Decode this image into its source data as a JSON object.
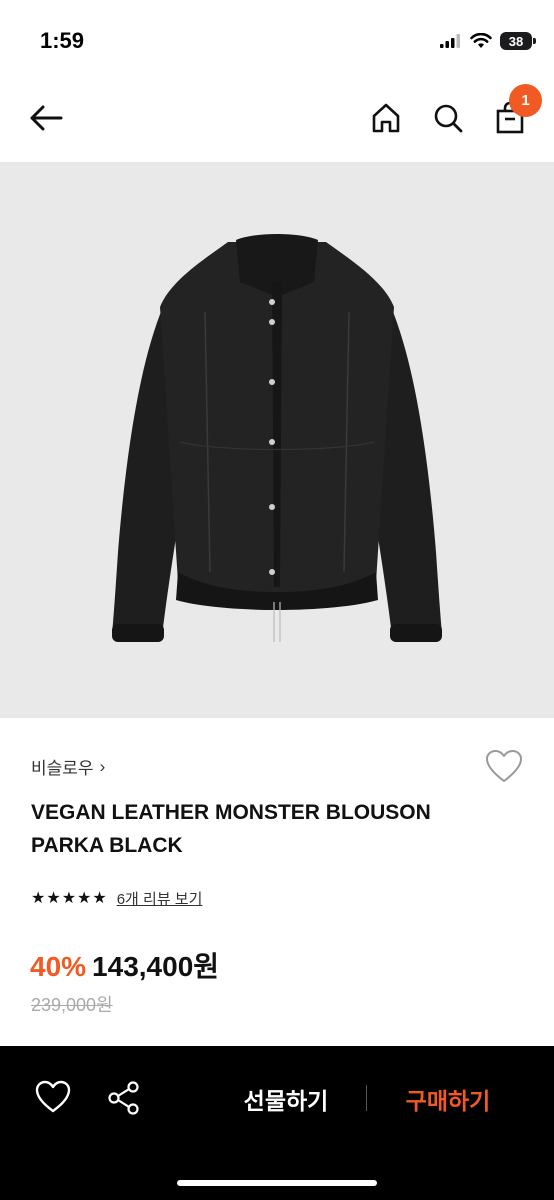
{
  "status": {
    "time": "1:59",
    "battery": "38",
    "icons": [
      "cellular-signal-icon",
      "wifi-icon",
      "battery-icon"
    ]
  },
  "header": {
    "icons": [
      "back-arrow-icon",
      "home-icon",
      "search-icon",
      "shopping-bag-icon"
    ],
    "cart_count": "1"
  },
  "product": {
    "brand": "비슬로우",
    "brand_chevron": "›",
    "name": "VEGAN LEATHER MONSTER BLOUSON PARKA BLACK",
    "rating_stars": 5,
    "review_link": "6개 리뷰 보기",
    "discount": "40%",
    "price": "143,400원",
    "original_price": "239,000원"
  },
  "bottom_bar": {
    "gift_label": "선물하기",
    "buy_label": "구매하기",
    "icons": [
      "heart-icon",
      "share-icon"
    ]
  },
  "colors": {
    "accent": "#f15a22",
    "image_bg": "#e9e9e9",
    "bottom_bar_bg": "#000000"
  }
}
